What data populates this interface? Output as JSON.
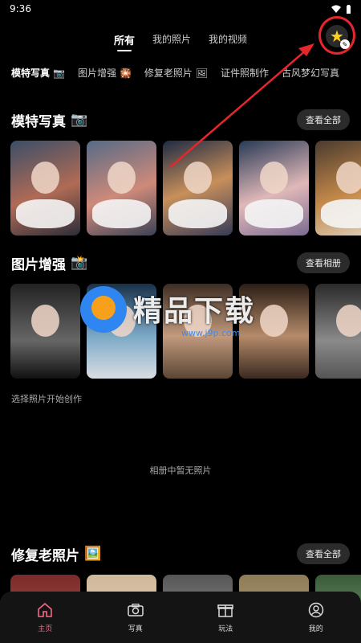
{
  "status_bar": {
    "time": "9:36",
    "icons": [
      "wifi-icon",
      "battery-icon"
    ]
  },
  "top_tabs": [
    {
      "label": "所有",
      "active": true
    },
    {
      "label": "我的照片",
      "active": false
    },
    {
      "label": "我的视频",
      "active": false
    }
  ],
  "favorite_button": {
    "icon": "star-icon",
    "badge_icon": "edit-icon"
  },
  "category_tabs": [
    {
      "label": "模特写真 📷",
      "active": true
    },
    {
      "label": "图片增强 🎇",
      "active": false
    },
    {
      "label": "修复老照片 🖼",
      "active": false
    },
    {
      "label": "证件照制作 ",
      "active": false
    },
    {
      "label": "古风梦幻写真",
      "active": false
    }
  ],
  "sections": {
    "model": {
      "title": "模特写真",
      "emoji": "📷",
      "action": "查看全部"
    },
    "enhance": {
      "title": "图片增强",
      "emoji": "📸",
      "action": "查看相册",
      "hint": "选择照片开始创作",
      "empty_text": "相册中暂无照片"
    },
    "restore": {
      "title": "修复老照片",
      "emoji": "🖼️",
      "action": "查看全部"
    }
  },
  "watermark": {
    "text": "精品下载",
    "url": "www.j9p.com"
  },
  "bottom_nav": [
    {
      "label": "主页",
      "icon": "home-icon",
      "active": true
    },
    {
      "label": "写真",
      "icon": "camera-icon",
      "active": false
    },
    {
      "label": "玩法",
      "icon": "gift-icon",
      "active": false
    },
    {
      "label": "我的",
      "icon": "user-icon",
      "active": false
    }
  ],
  "colors": {
    "accent": "#f36a85",
    "annotation": "#e6262c",
    "background": "#000000"
  }
}
